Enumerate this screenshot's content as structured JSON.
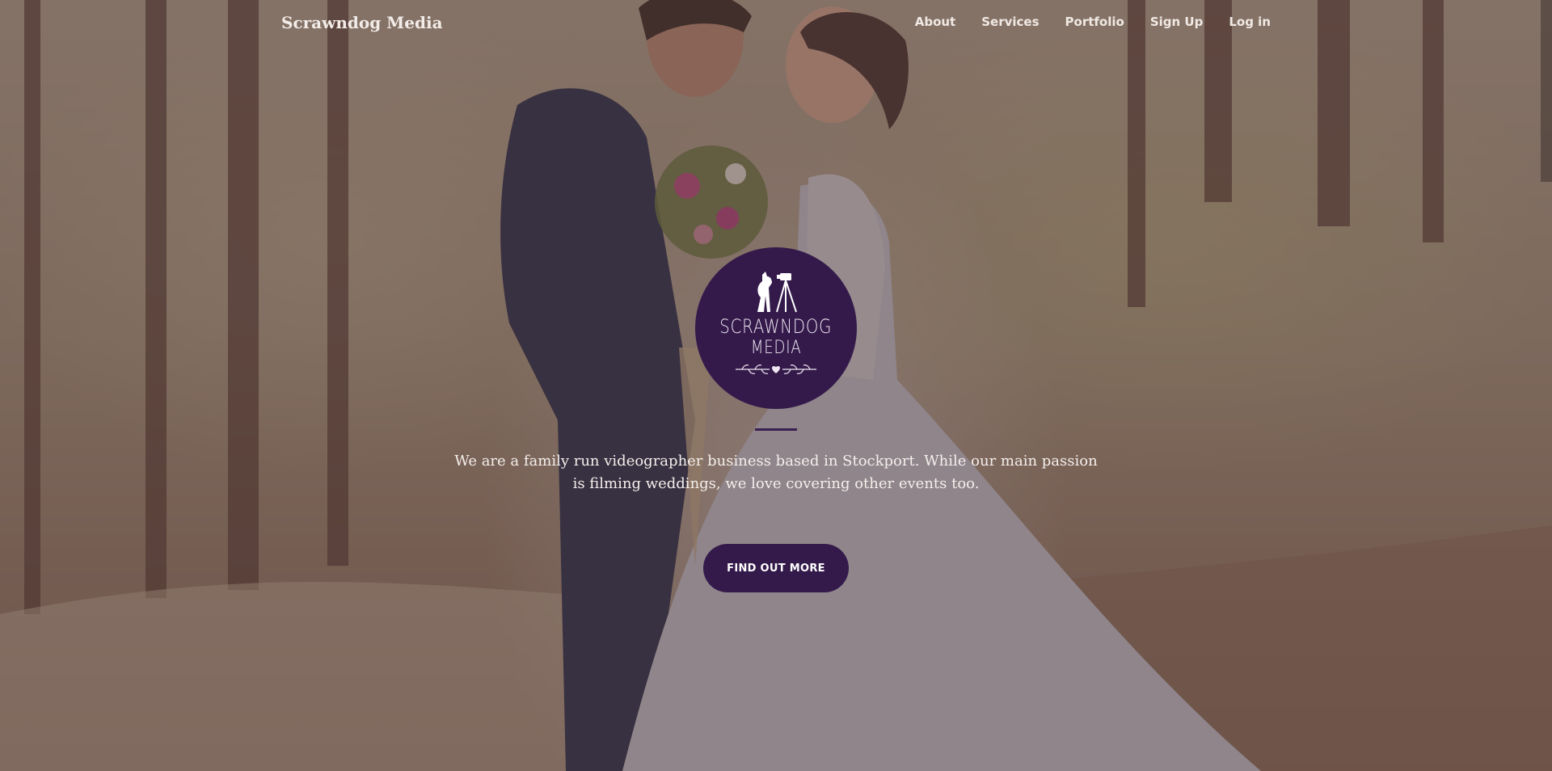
{
  "brand": {
    "name": "Scrawndog Media"
  },
  "nav": {
    "links": [
      {
        "label": "About"
      },
      {
        "label": "Services"
      },
      {
        "label": "Portfolio"
      },
      {
        "label": "Sign Up"
      },
      {
        "label": "Log in"
      }
    ]
  },
  "hero": {
    "logo": {
      "icon": "dog-camera-tripod-icon",
      "line1": "SCRAWNDOG",
      "line2": "MEDIA",
      "ornament": "laurel-heart-icon"
    },
    "tagline": "We are a family run videographer business based in Stockport. While our main passion is filming weddings, we love covering other events too.",
    "cta_label": "FIND OUT MORE",
    "background": "wedding-couple-forest-photo"
  },
  "colors": {
    "accent": "#341a4b",
    "overlay": "#4a363a",
    "text_light": "#f4efec"
  }
}
